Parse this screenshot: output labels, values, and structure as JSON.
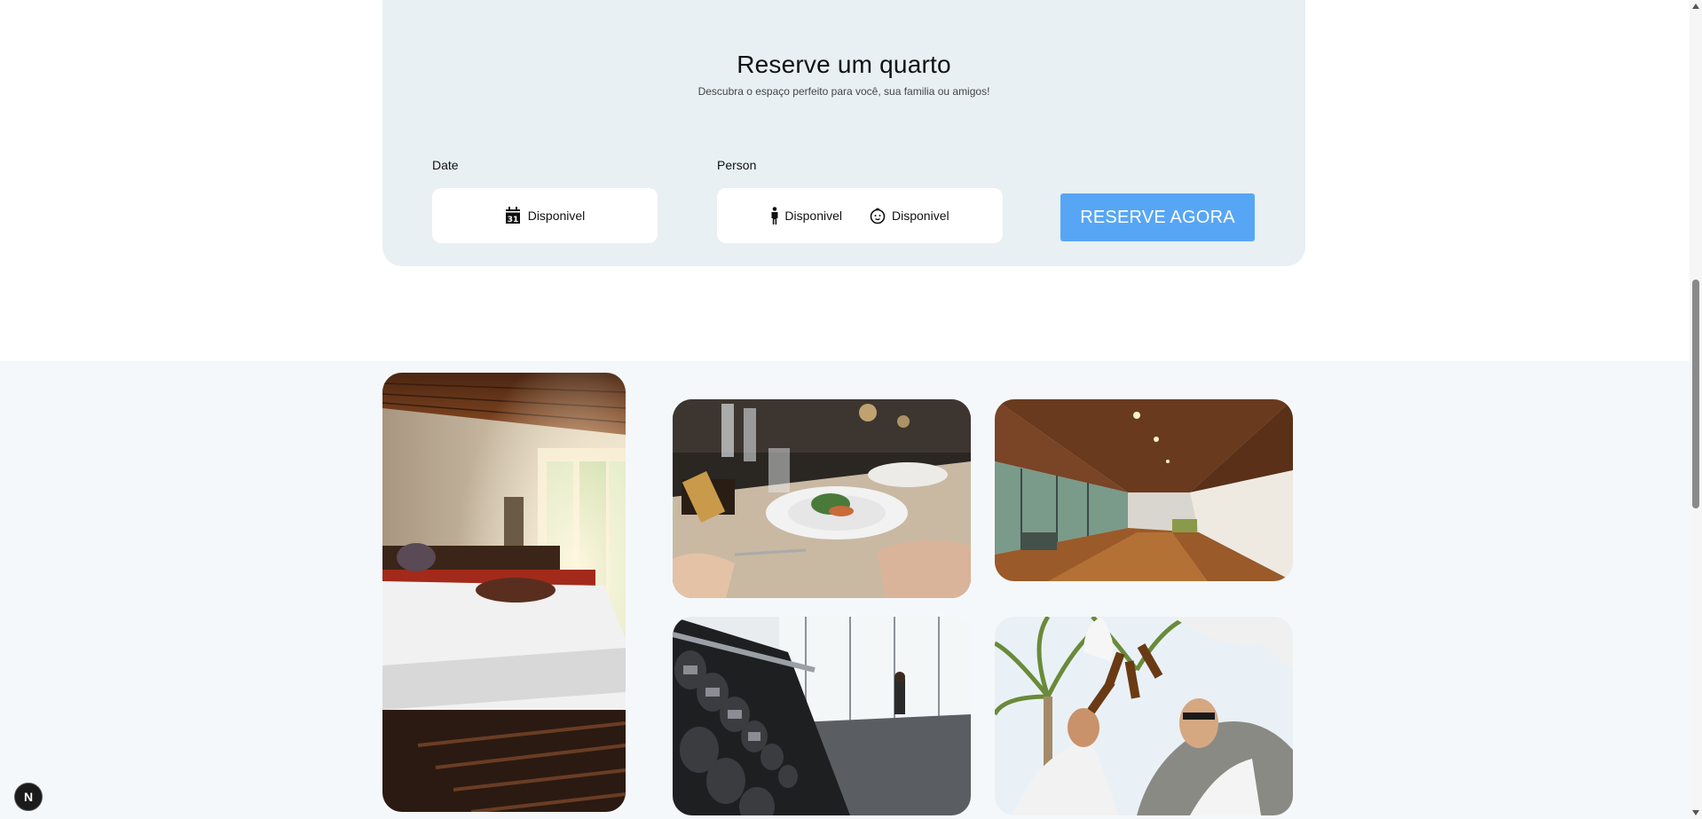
{
  "booking": {
    "title": "Reserve um quarto",
    "subtitle": "Descubra o espaço perfeito para você, sua familia ou amigos!",
    "date_label": "Date",
    "date_value": "Disponivel",
    "person_label": "Person",
    "adults_value": "Disponivel",
    "children_value": "Disponivel",
    "reserve_button": "RESERVE AGORA",
    "accent_color": "#57a6f5",
    "card_color": "#e8f0f4"
  },
  "gallery": {
    "photos": [
      "hotel-room",
      "dining",
      "lobby",
      "gym",
      "party"
    ]
  },
  "badge": {
    "label": "N"
  },
  "icons": [
    "calendar-icon",
    "person-icon",
    "baby-icon"
  ]
}
